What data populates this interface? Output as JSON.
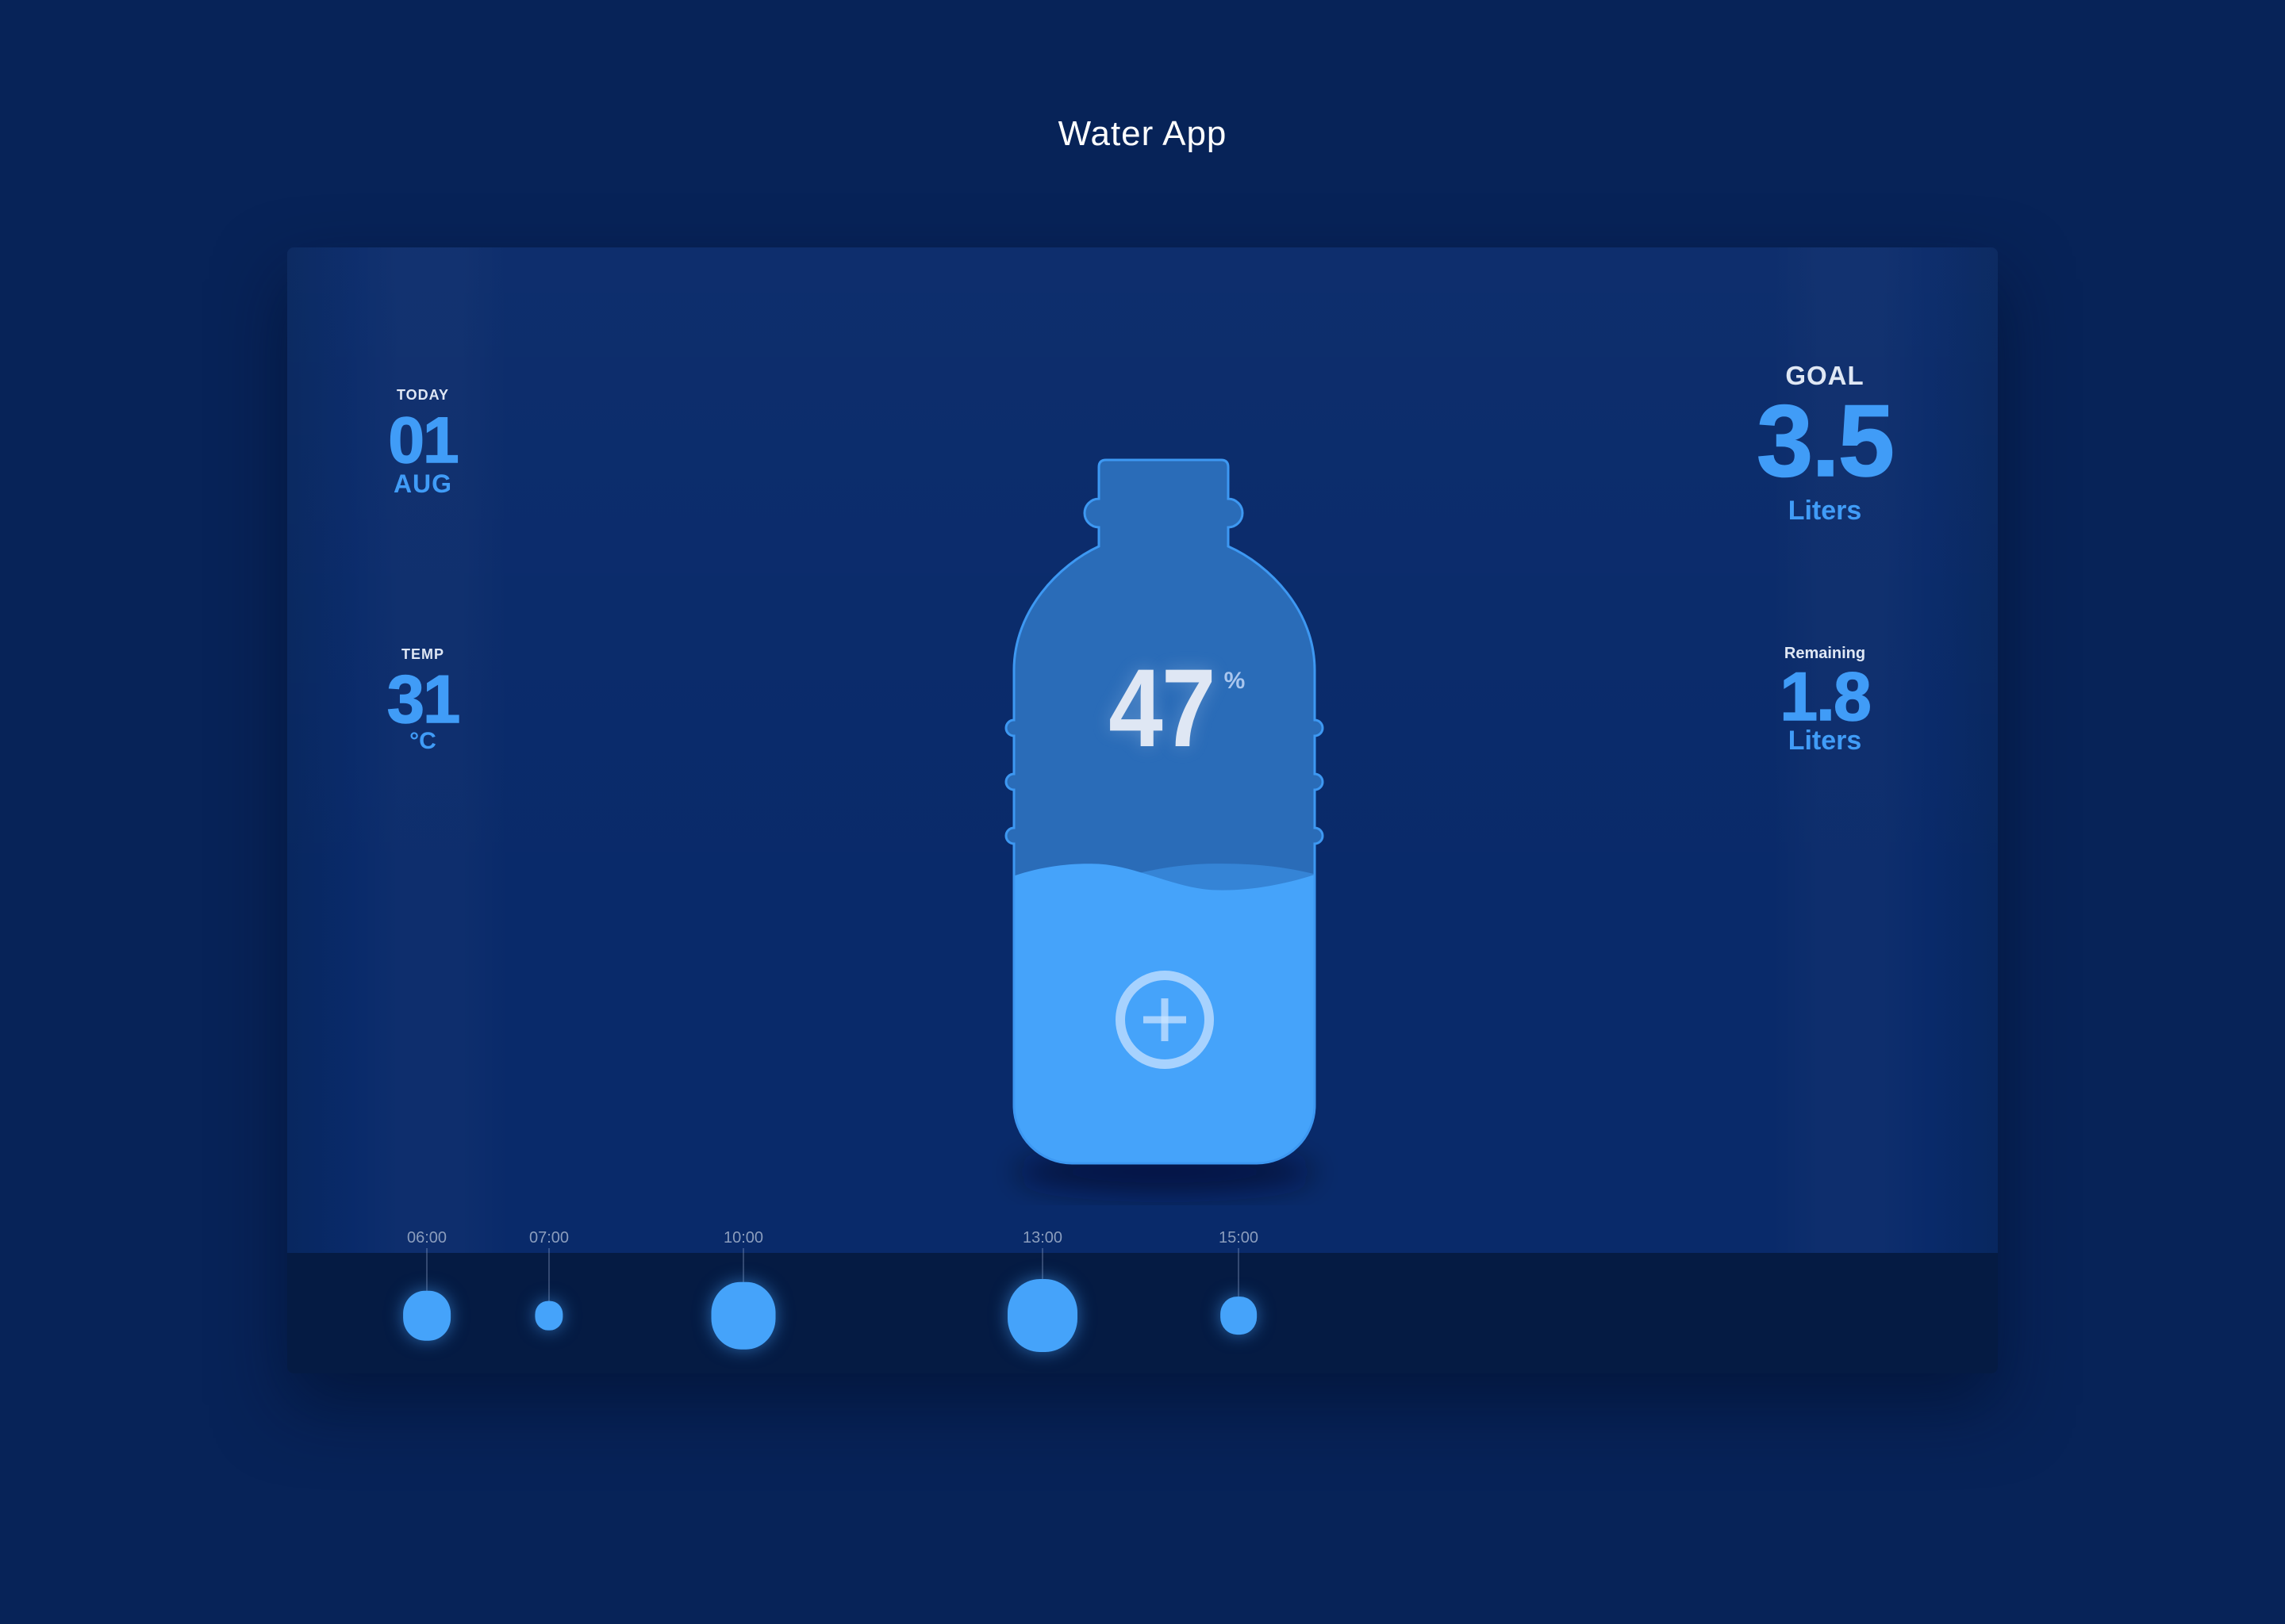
{
  "app": {
    "title": "Water App"
  },
  "today": {
    "label": "TODAY",
    "day": "01",
    "month": "AUG"
  },
  "temp": {
    "label": "TEMP",
    "value": "31",
    "unit": "°C"
  },
  "goal": {
    "label": "GOAL",
    "value": "3.5",
    "unit": "Liters"
  },
  "remaining": {
    "label": "Remaining",
    "value": "1.8",
    "unit": "Liters"
  },
  "bottle": {
    "percent": "47",
    "percent_sign": "%"
  },
  "icons": {
    "add": "plus-circle-icon"
  },
  "timeline": [
    {
      "time": "06:00",
      "intake_level": 0.68
    },
    {
      "time": "07:00",
      "intake_level": 0.4
    },
    {
      "time": "10:00",
      "intake_level": 0.92
    },
    {
      "time": "13:00",
      "intake_level": 1.0
    },
    {
      "time": "15:00",
      "intake_level": 0.52
    }
  ],
  "colors": {
    "background": "#072358",
    "card": "#092a6a",
    "timeline_bar": "#051b43",
    "accent": "#409cf7",
    "water": "#45a3fa",
    "bottle": "#2a6cb8",
    "light_text": "#dfe7f4",
    "muted_text": "#8b9dbd"
  }
}
